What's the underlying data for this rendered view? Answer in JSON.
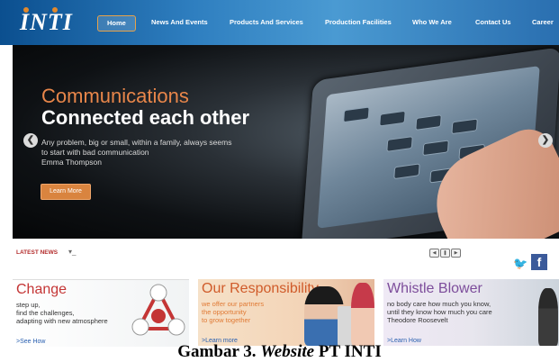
{
  "header": {
    "logo_text": "INTI",
    "nav": [
      {
        "label": "Home",
        "active": true
      },
      {
        "label": "News And Events"
      },
      {
        "label": "Products And Services"
      },
      {
        "label": "Production Facilities"
      },
      {
        "label": "Who We Are"
      },
      {
        "label": "Contact Us"
      },
      {
        "label": "Career"
      }
    ]
  },
  "hero": {
    "title": "Communications",
    "subtitle": "Connected each other",
    "body": "Any problem, big or small, within a family, always seems to start with bad communication",
    "attribution": "Emma Thompson",
    "button": "Learn More"
  },
  "latest": {
    "label": "LATEST NEWS"
  },
  "cards": [
    {
      "title": "Change",
      "lines": [
        "step up,",
        "find the challenges,",
        "adapting with new atmosphere"
      ],
      "link": ">See How"
    },
    {
      "title": "Our Responsibility",
      "lines": [
        "we offer our partners",
        "the opportunity",
        "to grow together"
      ],
      "link": ">Learn more"
    },
    {
      "title": "Whistle Blower",
      "lines": [
        "no body care how much you know,",
        "until they know how much you care",
        "Theodore Roosevelt"
      ],
      "link": ">Learn How"
    }
  ],
  "caption": {
    "prefix": "Gambar 3. ",
    "italic": "Website",
    "suffix": " PT INTI"
  },
  "colors": {
    "accent_orange": "#d9843f",
    "nav_blue": "#2f7fc0",
    "facebook": "#3b5a9a",
    "twitter": "#2fa8e0"
  }
}
